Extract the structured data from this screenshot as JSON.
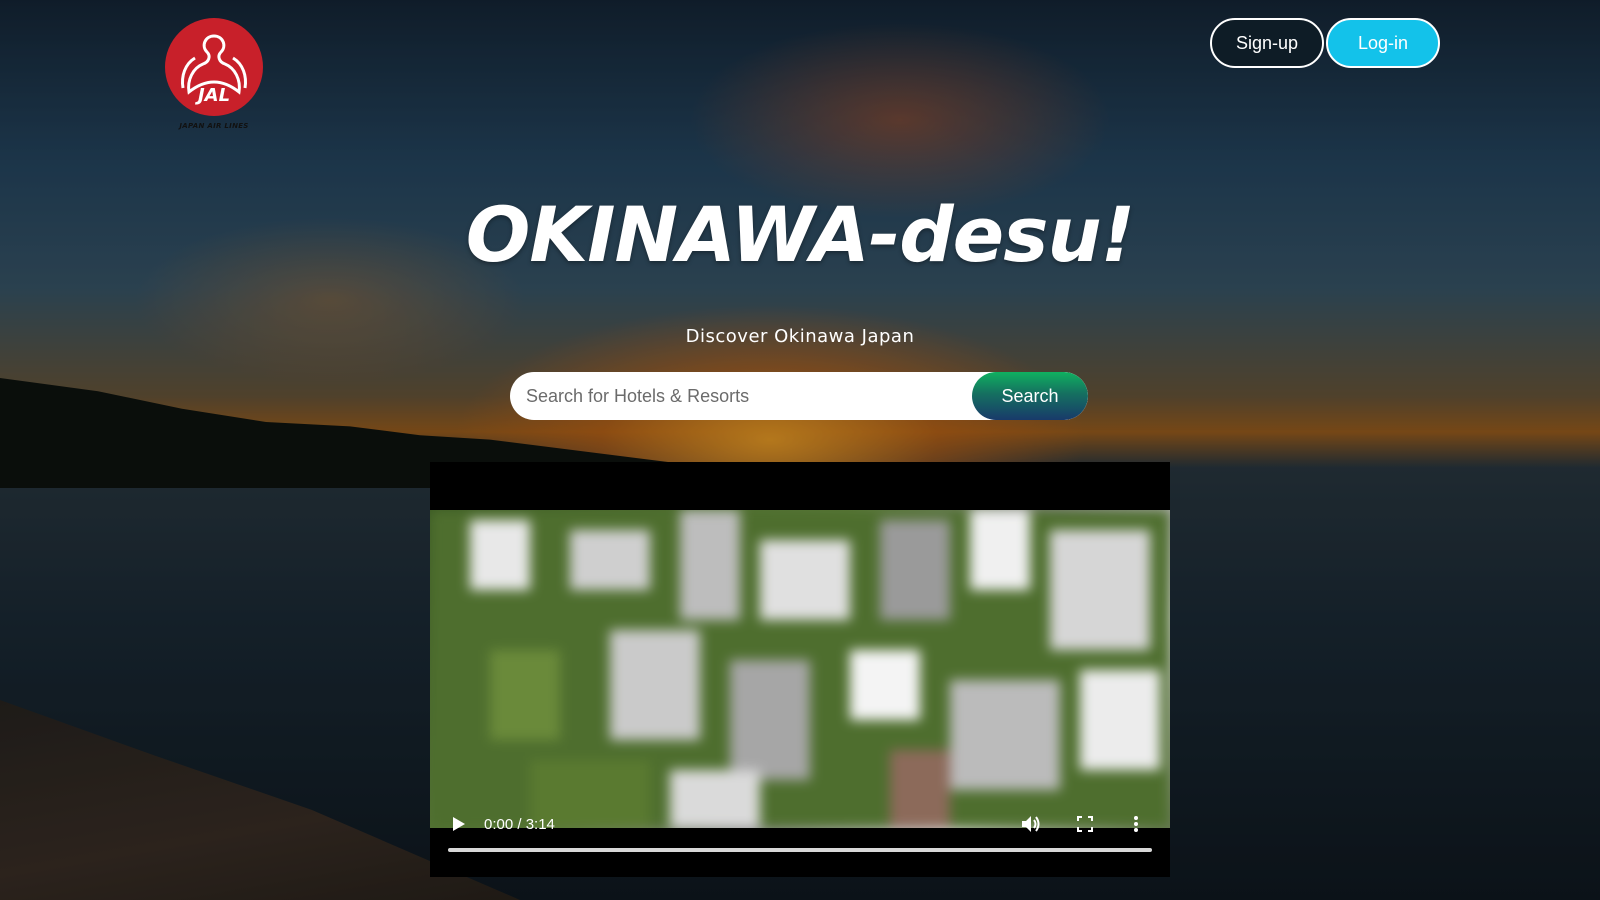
{
  "brand": {
    "logo_text": "JAL",
    "logo_subtext": "JAPAN AIR LINES"
  },
  "header": {
    "signup_label": "Sign-up",
    "login_label": "Log-in"
  },
  "hero": {
    "title": "OKINAWA-desu!",
    "subtitle": "Discover Okinawa Japan"
  },
  "search": {
    "placeholder": "Search for Hotels & Resorts",
    "value": "",
    "button_label": "Search"
  },
  "video": {
    "time_display": "0:00 / 3:14",
    "progress": 0
  },
  "colors": {
    "login_accent": "#13c2ea",
    "logo_red": "#c8202a",
    "search_button_top": "#10b060",
    "search_button_bottom": "#183a6a"
  },
  "icons": {
    "play": "play-icon",
    "volume": "volume-icon",
    "fullscreen": "fullscreen-icon",
    "more": "more-options-icon"
  }
}
